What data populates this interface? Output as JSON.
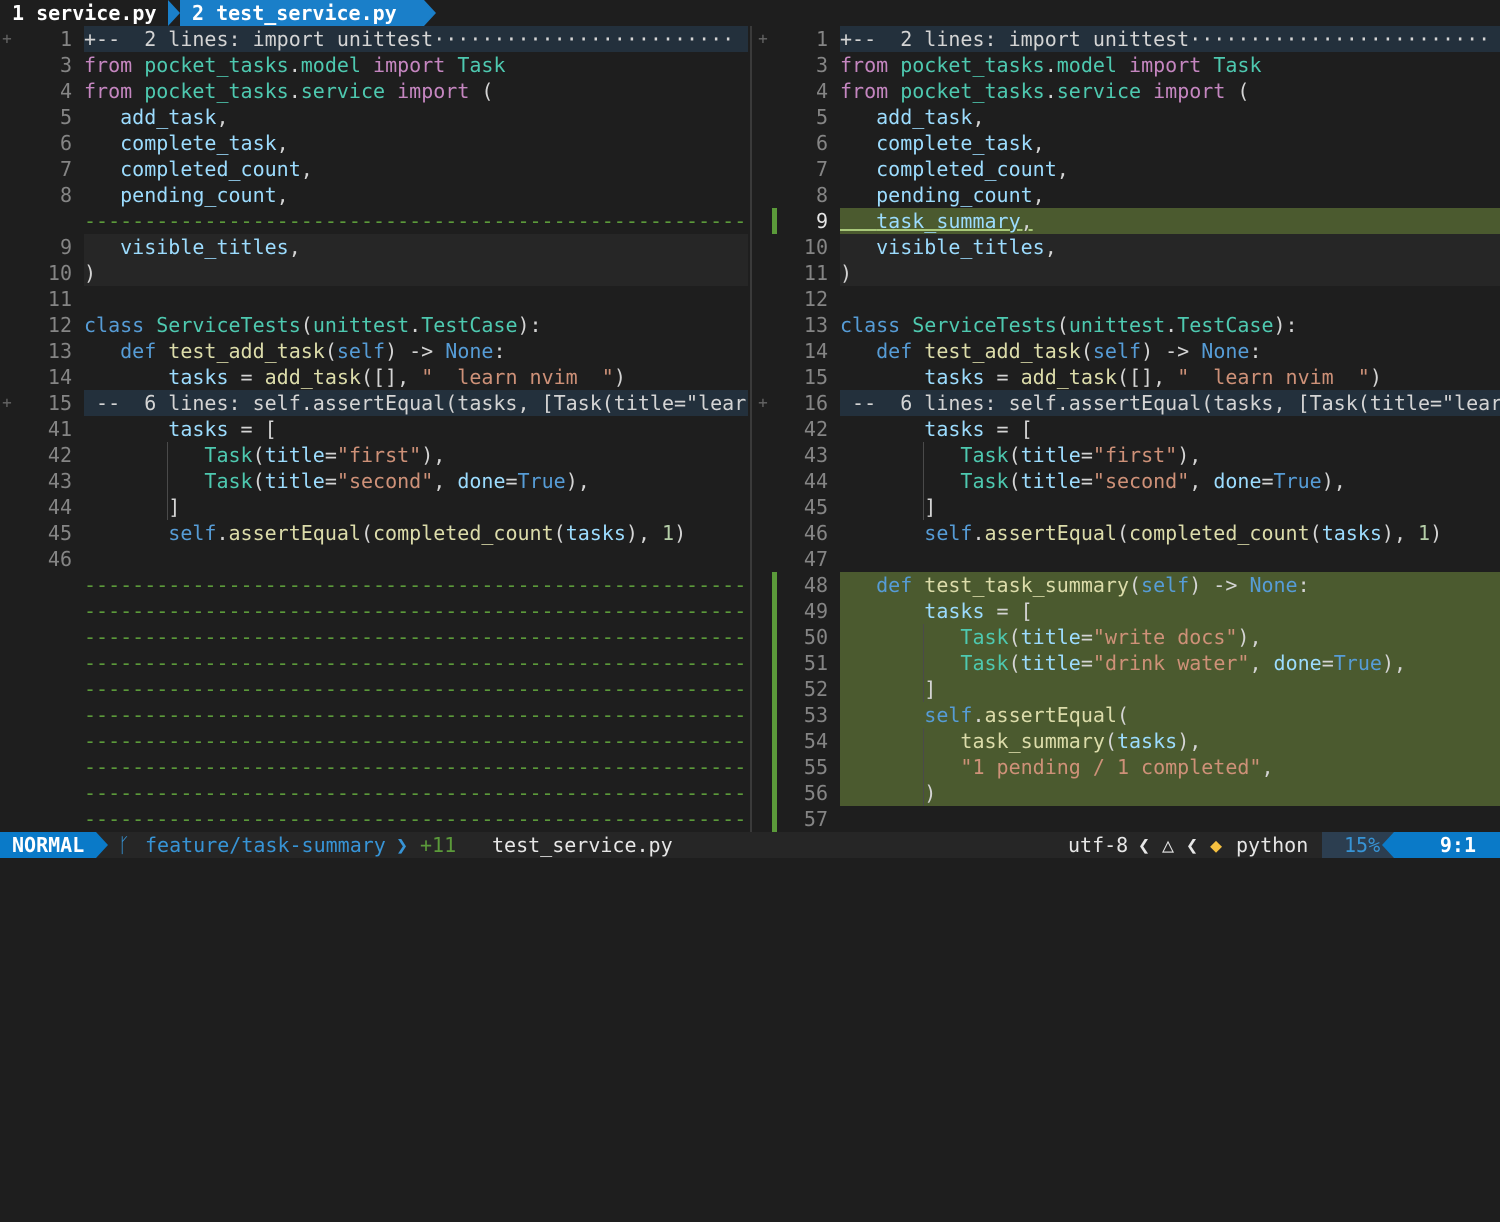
{
  "tabs": [
    {
      "number": "1",
      "name": "service.py"
    },
    {
      "number": "2",
      "name": "test_service.py"
    }
  ],
  "left_pane": {
    "rows": [
      {
        "kind": "fold",
        "sign": "+",
        "num": "1",
        "text": "+--  2 lines: import unittest·························"
      },
      {
        "kind": "code",
        "num": "3",
        "html": "<span class='kw'>from</span> <span class='ty'>pocket_tasks</span>.<span class='ty'>model</span> <span class='kw'>import</span> <span class='ty'>Task</span>"
      },
      {
        "kind": "code",
        "num": "4",
        "html": "<span class='kw'>from</span> <span class='ty'>pocket_tasks</span>.<span class='ty'>service</span> <span class='kw'>import</span> ("
      },
      {
        "kind": "code",
        "num": "5",
        "html": "<span class='guide'></span>   <span class='vr'>add_task</span>,"
      },
      {
        "kind": "code",
        "num": "6",
        "html": "<span class='guide'></span>   <span class='vr'>complete_task</span>,"
      },
      {
        "kind": "code",
        "num": "7",
        "html": "<span class='guide'></span>   <span class='vr'>completed_count</span>,"
      },
      {
        "kind": "code",
        "num": "8",
        "html": "<span class='guide'></span>   <span class='vr'>pending_count</span>,"
      },
      {
        "kind": "filler",
        "num": "",
        "text": "-------------------------------------------------------"
      },
      {
        "kind": "chg",
        "num": "9",
        "html": "<span class='guide'></span>   <span class='vr'>visible_titles</span>,"
      },
      {
        "kind": "chg",
        "num": "10",
        "html": ")"
      },
      {
        "kind": "code",
        "num": "11",
        "html": ""
      },
      {
        "kind": "code",
        "num": "12",
        "html": "<span class='bl'>class</span> <span class='ty'>ServiceTests</span>(<span class='ty'>unittest</span>.<span class='ty'>TestCase</span>):"
      },
      {
        "kind": "code",
        "num": "13",
        "html": "<span class='guide'></span>   <span class='bl'>def</span> <span class='fn'>test_add_task</span>(<span class='bl'>self</span>) -&gt; <span class='bl'>None</span>:"
      },
      {
        "kind": "code",
        "num": "14",
        "html": "<span class='guide'></span>       <span class='vr'>tasks</span> = <span class='fn'>add_task</span>([], <span class='st'>\"  learn nvim  \"</span>)"
      },
      {
        "kind": "fold",
        "sign": "+",
        "num": "15",
        "text": " --  6 lines: self.assertEqual(tasks, [Task(title=\"lear"
      },
      {
        "kind": "code",
        "num": "41",
        "html": "<span class='guide'></span>       <span class='vr'>tasks</span> = ["
      },
      {
        "kind": "code",
        "num": "42",
        "html": "<span class='guide'></span>       <span class='guide'></span>   <span class='ty'>Task</span>(<span class='vr'>title</span>=<span class='st'>\"first\"</span>),"
      },
      {
        "kind": "code",
        "num": "43",
        "html": "<span class='guide'></span>       <span class='guide'></span>   <span class='ty'>Task</span>(<span class='vr'>title</span>=<span class='st'>\"second\"</span>, <span class='vr'>done</span>=<span class='bl'>True</span>),"
      },
      {
        "kind": "code",
        "num": "44",
        "html": "<span class='guide'></span>       <span class='guide'></span>]"
      },
      {
        "kind": "code",
        "num": "45",
        "html": "<span class='guide'></span>       <span class='bl'>self</span>.<span class='fn'>assertEqual</span>(<span class='fn'>completed_count</span>(<span class='vr'>tasks</span>), <span class='nm'>1</span>)"
      },
      {
        "kind": "code",
        "num": "46",
        "html": ""
      },
      {
        "kind": "filler",
        "num": "",
        "text": "-------------------------------------------------------"
      },
      {
        "kind": "filler",
        "num": "",
        "text": "-------------------------------------------------------"
      },
      {
        "kind": "filler",
        "num": "",
        "text": "-------------------------------------------------------"
      },
      {
        "kind": "filler",
        "num": "",
        "text": "-------------------------------------------------------"
      },
      {
        "kind": "filler",
        "num": "",
        "text": "-------------------------------------------------------"
      },
      {
        "kind": "filler",
        "num": "",
        "text": "-------------------------------------------------------"
      },
      {
        "kind": "filler",
        "num": "",
        "text": "-------------------------------------------------------"
      },
      {
        "kind": "filler",
        "num": "",
        "text": "-------------------------------------------------------"
      },
      {
        "kind": "filler",
        "num": "",
        "text": "-------------------------------------------------------"
      },
      {
        "kind": "filler",
        "num": "",
        "text": "-------------------------------------------------------"
      }
    ]
  },
  "right_pane": {
    "rows": [
      {
        "kind": "fold",
        "sign": "+",
        "num": "1",
        "text": "+--  2 lines: import unittest·························"
      },
      {
        "kind": "code",
        "num": "3",
        "html": "<span class='kw'>from</span> <span class='ty'>pocket_tasks</span>.<span class='ty'>model</span> <span class='kw'>import</span> <span class='ty'>Task</span>"
      },
      {
        "kind": "code",
        "num": "4",
        "html": "<span class='kw'>from</span> <span class='ty'>pocket_tasks</span>.<span class='ty'>service</span> <span class='kw'>import</span> ("
      },
      {
        "kind": "code",
        "num": "5",
        "html": "<span class='guide'></span>   <span class='vr'>add_task</span>,"
      },
      {
        "kind": "code",
        "num": "6",
        "html": "<span class='guide'></span>   <span class='vr'>complete_task</span>,"
      },
      {
        "kind": "code",
        "num": "7",
        "html": "<span class='guide'></span>   <span class='vr'>completed_count</span>,"
      },
      {
        "kind": "code",
        "num": "8",
        "html": "<span class='guide'></span>   <span class='vr'>pending_count</span>,"
      },
      {
        "kind": "cursor",
        "bar": true,
        "cur": true,
        "num": "9",
        "html": "<span class='guide'></span>   <span class='vr'>task_summary</span>,"
      },
      {
        "kind": "chg",
        "num": "10",
        "html": "<span class='guide'></span>   <span class='vr'>visible_titles</span>,"
      },
      {
        "kind": "chg",
        "num": "11",
        "html": ")"
      },
      {
        "kind": "code",
        "num": "12",
        "html": ""
      },
      {
        "kind": "code",
        "num": "13",
        "html": "<span class='bl'>class</span> <span class='ty'>ServiceTests</span>(<span class='ty'>unittest</span>.<span class='ty'>TestCase</span>):"
      },
      {
        "kind": "code",
        "num": "14",
        "html": "<span class='guide'></span>   <span class='bl'>def</span> <span class='fn'>test_add_task</span>(<span class='bl'>self</span>) -&gt; <span class='bl'>None</span>:"
      },
      {
        "kind": "code",
        "num": "15",
        "html": "<span class='guide'></span>       <span class='vr'>tasks</span> = <span class='fn'>add_task</span>([], <span class='st'>\"  learn nvim  \"</span>)"
      },
      {
        "kind": "fold",
        "sign": "+",
        "num": "16",
        "text": " --  6 lines: self.assertEqual(tasks, [Task(title=\"lear"
      },
      {
        "kind": "code",
        "num": "42",
        "html": "<span class='guide'></span>       <span class='vr'>tasks</span> = ["
      },
      {
        "kind": "code",
        "num": "43",
        "html": "<span class='guide'></span>       <span class='guide'></span>   <span class='ty'>Task</span>(<span class='vr'>title</span>=<span class='st'>\"first\"</span>),"
      },
      {
        "kind": "code",
        "num": "44",
        "html": "<span class='guide'></span>       <span class='guide'></span>   <span class='ty'>Task</span>(<span class='vr'>title</span>=<span class='st'>\"second\"</span>, <span class='vr'>done</span>=<span class='bl'>True</span>),"
      },
      {
        "kind": "code",
        "num": "45",
        "html": "<span class='guide'></span>       <span class='guide'></span>]"
      },
      {
        "kind": "code",
        "num": "46",
        "html": "<span class='guide'></span>       <span class='bl'>self</span>.<span class='fn'>assertEqual</span>(<span class='fn'>completed_count</span>(<span class='vr'>tasks</span>), <span class='nm'>1</span>)"
      },
      {
        "kind": "code",
        "num": "47",
        "html": "<span class='guide'></span>"
      },
      {
        "kind": "add",
        "bar": true,
        "num": "48",
        "html": "<span class='guide'></span>   <span class='bl'>def</span> <span class='fn'>test_task_summary</span>(<span class='bl'>self</span>) -&gt; <span class='bl'>None</span>:"
      },
      {
        "kind": "add",
        "bar": true,
        "num": "49",
        "html": "<span class='guide'></span>       <span class='vr'>tasks</span> = ["
      },
      {
        "kind": "add",
        "bar": true,
        "num": "50",
        "html": "<span class='guide'></span>       <span class='guide'></span>   <span class='ty'>Task</span>(<span class='vr'>title</span>=<span class='st'>\"write docs\"</span>),"
      },
      {
        "kind": "add",
        "bar": true,
        "num": "51",
        "html": "<span class='guide'></span>       <span class='guide'></span>   <span class='ty'>Task</span>(<span class='vr'>title</span>=<span class='st'>\"drink water\"</span>, <span class='vr'>done</span>=<span class='bl'>True</span>),"
      },
      {
        "kind": "add",
        "bar": true,
        "num": "52",
        "html": "<span class='guide'></span>       <span class='guide'></span>]"
      },
      {
        "kind": "add",
        "bar": true,
        "num": "53",
        "html": "<span class='guide'></span>       <span class='bl'>self</span>.<span class='fn'>assertEqual</span>("
      },
      {
        "kind": "add",
        "bar": true,
        "num": "54",
        "html": "<span class='guide'></span>       <span class='guide'></span>   <span class='fn'>task_summary</span>(<span class='vr'>tasks</span>),"
      },
      {
        "kind": "add",
        "bar": true,
        "num": "55",
        "html": "<span class='guide'></span>       <span class='guide'></span>   <span class='st'>\"1 pending / 1 completed\"</span>,"
      },
      {
        "kind": "add",
        "bar": true,
        "num": "56",
        "html": "<span class='guide'></span>       <span class='guide'></span>)"
      },
      {
        "kind": "add",
        "bar": true,
        "num": "57",
        "html": ""
      }
    ]
  },
  "statusline": {
    "mode": "NORMAL",
    "branch_icon": "branch-icon",
    "branch": "feature/task-summary",
    "diff_count": "+11",
    "filename": "test_service.py",
    "encoding": "utf-8",
    "os_icon": "linux-icon",
    "lang_icon": "python-icon",
    "language": "python",
    "percent": "15%",
    "position": "9:1"
  },
  "colors": {
    "accent": "#0a7ac8",
    "added_bg": "#4b5a2f",
    "fold_bg": "#23303c",
    "diff_bar": "#5b9a3a"
  }
}
